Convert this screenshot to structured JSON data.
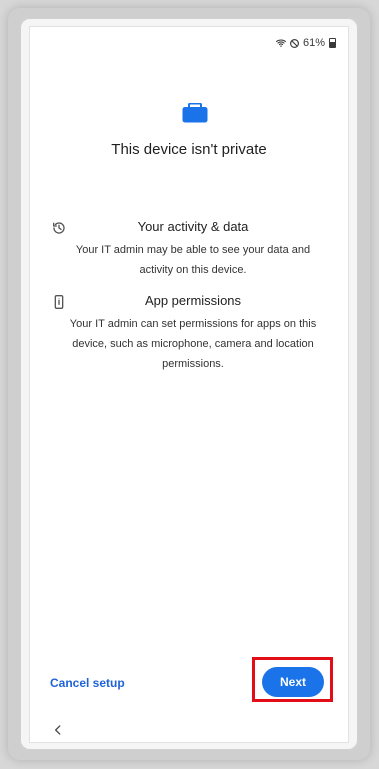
{
  "status_bar": {
    "battery_percent_text": "61%",
    "wifi_icon": "wifi-icon",
    "dnd_icon": "do-not-disturb-icon",
    "battery_icon": "battery-icon",
    "battery_level": 0.61
  },
  "hero": {
    "icon": "briefcase-icon",
    "title": "This device isn't private"
  },
  "sections": [
    {
      "icon": "history-icon",
      "title": "Your activity & data",
      "body": "Your IT admin may be able to see your data and activity on this device."
    },
    {
      "icon": "device-info-icon",
      "title": "App permissions",
      "body": "Your IT admin can set permissions for apps on this device, such as microphone, camera and location permissions."
    }
  ],
  "footer": {
    "cancel_label": "Cancel setup",
    "next_label": "Next"
  },
  "navigation": {
    "back_icon": "back-icon"
  },
  "colors": {
    "accent": "#1a73e8",
    "link": "#1f63d7",
    "highlight": "#e20d17"
  }
}
